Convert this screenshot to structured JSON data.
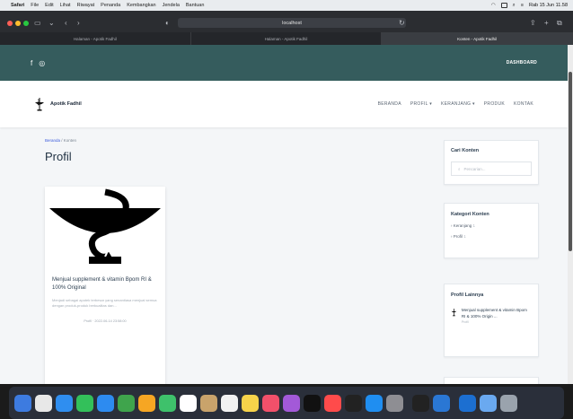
{
  "menubar": {
    "apple": "",
    "items": [
      "Safari",
      "File",
      "Edit",
      "Lihat",
      "Riwayat",
      "Penanda",
      "Kembangkan",
      "Jendela",
      "Bantuan"
    ],
    "datetime": "Rab 15 Jun 11.58"
  },
  "browser": {
    "url": "localhost",
    "tabs": [
      "Halaman - Apotik Fadhil",
      "Halaman - Apotik Fadhil",
      "Konten - Apotik Fadhil"
    ]
  },
  "topbar": {
    "social": [
      "f",
      "◎"
    ],
    "dashboard": "DASHBOARD"
  },
  "navbar": {
    "brand": "Apotik Fadhil",
    "items": [
      "BERANDA",
      "PROFIL ▾",
      "KERANJANG ▾",
      "PRODUK",
      "KONTAK"
    ]
  },
  "content": {
    "breadcrumb": {
      "home": "Beranda",
      "sep": " / ",
      "current": "Konten"
    },
    "title": "Profil",
    "card": {
      "title": "Menjual supplement & vitamin Bpom RI & 100% Original",
      "excerpt": "Menjadi sebagai apotek terbesar yang senantiasa menjual semua dengan produk-produk berkualitas dan...",
      "meta": "Profil · 2022-06-14 23:58:00"
    }
  },
  "sidebar": {
    "search": {
      "title": "Cari Konten",
      "placeholder": "Pencarian..."
    },
    "categories": {
      "title": "Kategori Konten",
      "items": [
        {
          "label": "Keranjang",
          "count": "1"
        },
        {
          "label": "Profil",
          "count": "1"
        }
      ]
    },
    "other": {
      "title": "Profil Lainnya",
      "item_title": "Menjual supplement & vitamin Bpom RI & 100% Origin ...",
      "item_sub": "Profil"
    }
  },
  "dock": {
    "apps": [
      "Finder",
      "Launchpad",
      "Safari",
      "Messages",
      "Mail",
      "Maps",
      "Photos",
      "FaceTime",
      "Calendar",
      "Contacts",
      "Reminders",
      "Notes",
      "Music",
      "Podcasts",
      "TV",
      "News",
      "Stocks",
      "App Store",
      "System Preferences",
      "Terminal",
      "Code",
      "Xcode",
      "Preview",
      "Trash"
    ]
  },
  "colors": {
    "topbar": "#355c5d",
    "page_bg": "#f4f6f8",
    "accent": "#3b5bdb"
  }
}
